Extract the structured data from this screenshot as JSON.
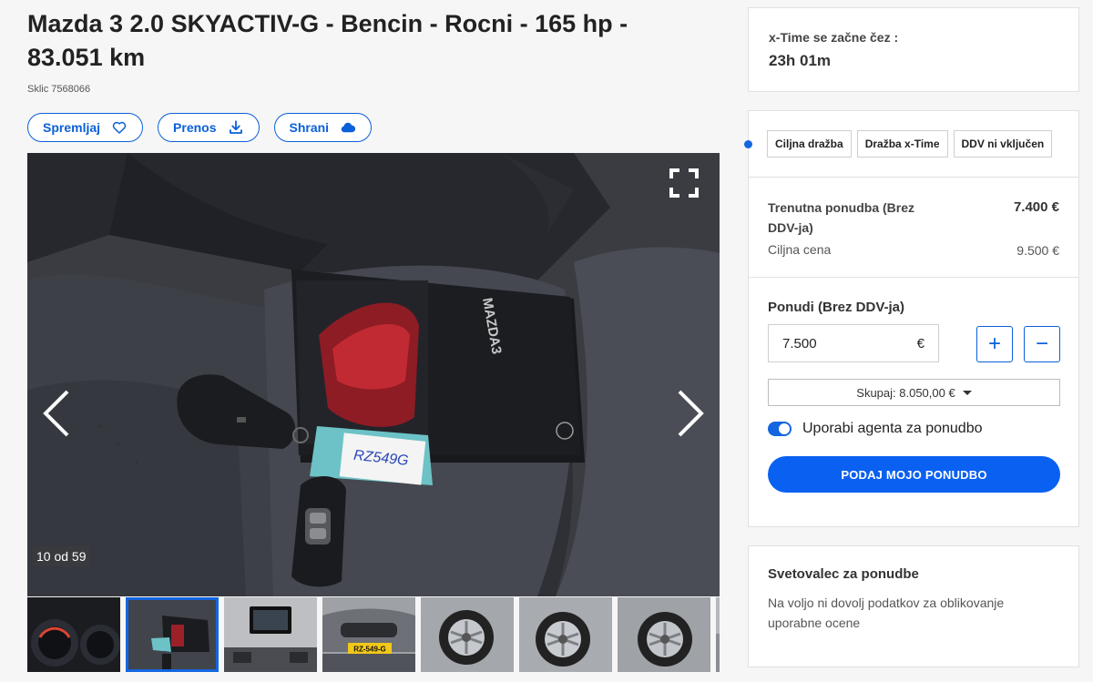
{
  "listing": {
    "title": "Mazda 3 2.0 SKYACTIV-G - Bencin - Rocni - 165 hp - 83.051 km",
    "reference": "Sklic 7568066"
  },
  "actions": {
    "follow_label": "Spremljaj",
    "follow_icon": "heart-icon",
    "transfer_label": "Prenos",
    "transfer_icon": "download-icon",
    "save_label": "Shrani",
    "save_icon": "cloud-icon"
  },
  "gallery": {
    "counter": "10 od 59",
    "current_index": 10,
    "total": 59,
    "key_tag_text": "RZ549G",
    "manual_brand": "MAZDA3",
    "thumbnails": [
      {
        "name": "thumb-dashboard",
        "active": false
      },
      {
        "name": "thumb-keys",
        "active": true
      },
      {
        "name": "thumb-infotainment",
        "active": false
      },
      {
        "name": "thumb-front",
        "active": false,
        "plate": "RZ-549-G"
      },
      {
        "name": "thumb-wheel-1",
        "active": false
      },
      {
        "name": "thumb-wheel-2",
        "active": false
      },
      {
        "name": "thumb-wheel-3",
        "active": false
      },
      {
        "name": "thumb-partial",
        "active": false
      }
    ]
  },
  "timer": {
    "label": "x-Time se začne čez :",
    "value": "23h 01m"
  },
  "bid": {
    "tags": [
      "Ciljna dražba",
      "Dražba x-Time",
      "DDV ni vključen"
    ],
    "current_label": "Trenutna ponudba (Brez DDV-ja)",
    "current_value": "7.400 €",
    "target_label": "Ciljna cena",
    "target_value": "9.500 €",
    "offer_label": "Ponudi (Brez DDV-ja)",
    "offer_value": "7.500",
    "currency": "€",
    "plus": "+",
    "minus": "−",
    "total": "Skupaj: 8.050,00 €",
    "agent_label": "Uporabi agenta za ponudbo",
    "agent_enabled": true,
    "submit_label": "PODAJ MOJO PONUDBO"
  },
  "advisor": {
    "title": "Svetovalec za ponudbe",
    "text": "Na voljo ni dovolj podatkov za oblikovanje uporabne ocene"
  },
  "colors": {
    "accent": "#0a60d8",
    "button": "#0a60f0",
    "background": "#f6f6f6"
  }
}
